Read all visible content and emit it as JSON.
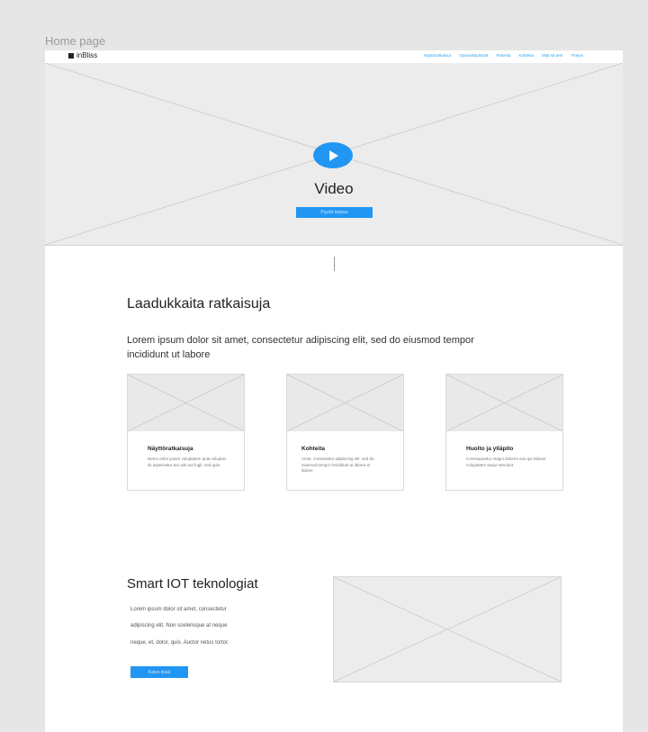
{
  "frame_label": "Home page",
  "nav": {
    "brand": "inBliss",
    "links": [
      "Näyttöratkaisut",
      "Opetuskäytössä",
      "Palvelut",
      "Kohteita",
      "Mitä sä teet",
      "Yhteys"
    ]
  },
  "hero": {
    "title": "Video",
    "button_label": "Pyydä tarjous"
  },
  "solutions": {
    "title": "Laadukkaita ratkaisuja",
    "lead": "Lorem ipsum dolor sit amet, consectetur adipiscing elit, sed do eiusmod tempor incididunt ut labore",
    "cards": [
      {
        "title": "Näyttöratkaisuja",
        "text": "Nemo enim ipsam voluptatem quia voluptas sit aspernatur aut odit aut fugit, sed quia."
      },
      {
        "title": "Kohteita",
        "text": "Amet, consectetur adipiscing elit, sed do eiusmod tempor incididunt ut labore et dolore."
      },
      {
        "title": "Huolto ja ylläpito",
        "text": "Consequuntur magni dolores eos qui ratione voluptatem sequi nesciunt."
      }
    ]
  },
  "iot": {
    "title": "Smart IOT teknologiat",
    "lines": [
      "Lorem ipsum dolor sit amet, consectetur",
      "adipiscing elit. Non scelerisque at neque",
      "neque, et, dolor, quis. Auctor netus tortor."
    ],
    "button_label": "Katso lisää"
  },
  "colors": {
    "accent": "#2196f3",
    "background": "#e6e6e6",
    "placeholder": "#ececec"
  }
}
